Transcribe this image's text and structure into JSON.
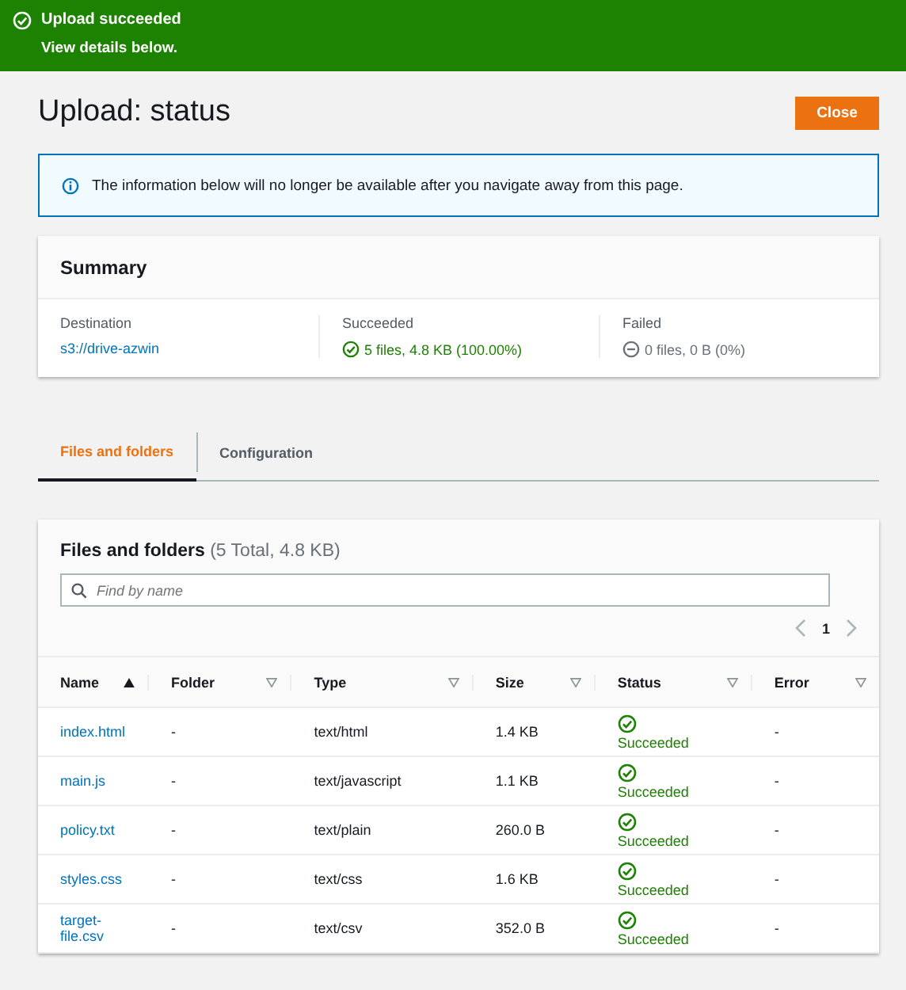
{
  "banner": {
    "title": "Upload succeeded",
    "message": "View details below."
  },
  "page": {
    "title": "Upload: status",
    "close_button": "Close"
  },
  "info": {
    "text": "The information below will no longer be available after you navigate away from this page."
  },
  "summary": {
    "title": "Summary",
    "items": [
      {
        "kind": "link",
        "label": "Destination",
        "value": "s3://drive-azwin"
      },
      {
        "kind": "success",
        "label": "Succeeded",
        "value": "5 files, 4.8 KB (100.00%)"
      },
      {
        "kind": "failed",
        "label": "Failed",
        "value": "0 files, 0 B (0%)"
      }
    ]
  },
  "tabs": [
    {
      "label": "Files and folders",
      "selected": true
    },
    {
      "label": "Configuration",
      "selected": false
    }
  ],
  "table": {
    "title": "Files and folders",
    "count": "(5 Total, 4.8 KB)",
    "search": {
      "placeholder": "Find by name"
    },
    "page": "1",
    "columns": [
      {
        "label": "Name",
        "sorted": true
      },
      {
        "label": "Folder",
        "sorted": false
      },
      {
        "label": "Type",
        "sorted": false
      },
      {
        "label": "Size",
        "sorted": false
      },
      {
        "label": "Status",
        "sorted": false
      },
      {
        "label": "Error",
        "sorted": false
      }
    ],
    "rows": [
      {
        "name": "index.html",
        "folder": "-",
        "type": "text/html",
        "size": "1.4 KB",
        "status": {
          "kind": "succeeded",
          "text": "Succeeded"
        },
        "error": "-"
      },
      {
        "name": "main.js",
        "folder": "-",
        "type": "text/javascript",
        "size": "1.1 KB",
        "status": {
          "kind": "succeeded",
          "text": "Succeeded"
        },
        "error": "-"
      },
      {
        "name": "policy.txt",
        "folder": "-",
        "type": "text/plain",
        "size": "260.0 B",
        "status": {
          "kind": "succeeded",
          "text": "Succeeded"
        },
        "error": "-"
      },
      {
        "name": "styles.css",
        "folder": "-",
        "type": "text/css",
        "size": "1.6 KB",
        "status": {
          "kind": "succeeded",
          "text": "Succeeded"
        },
        "error": "-"
      },
      {
        "name": "target-file.csv",
        "folder": "-",
        "type": "text/csv",
        "size": "352.0 B",
        "status": {
          "kind": "succeeded",
          "text": "Succeeded"
        },
        "error": "-"
      }
    ]
  }
}
